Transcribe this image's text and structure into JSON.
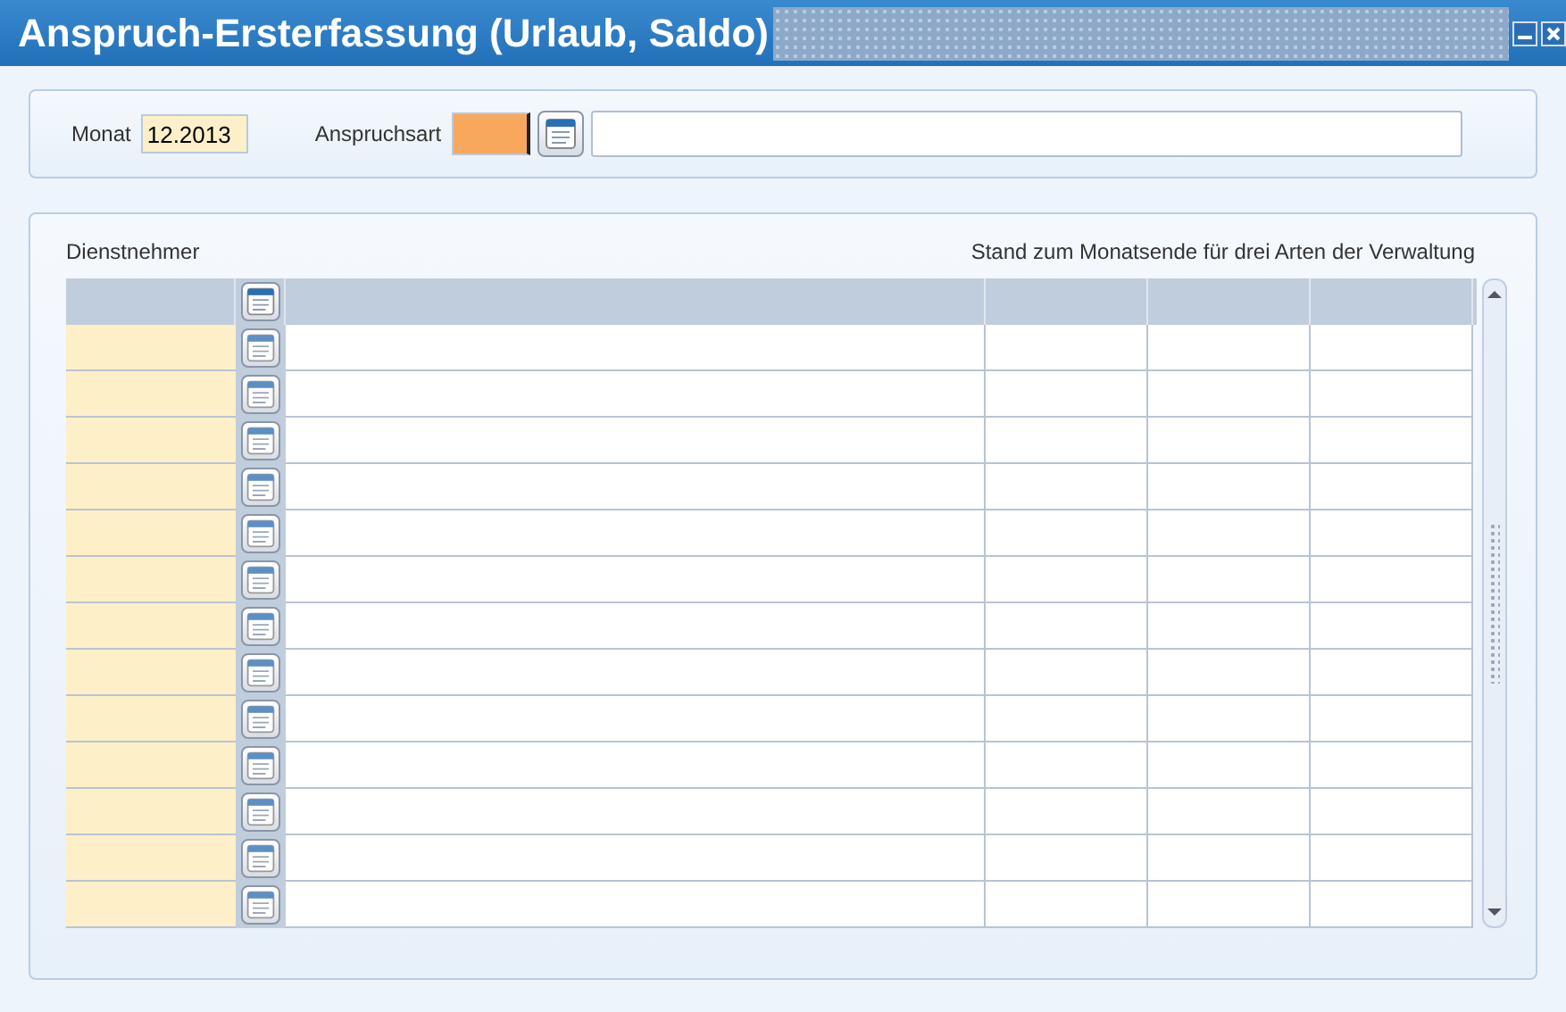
{
  "window": {
    "title": "Anspruch-Ersterfassung (Urlaub, Saldo)"
  },
  "filter": {
    "month_label": "Monat",
    "month_value": "12.2013",
    "type_label": "Anspruchsart",
    "type_focused": true,
    "type_lookup": true
  },
  "table": {
    "left_label": "Dienstnehmer",
    "right_label": "Stand zum Monatsende für drei Arten der Verwaltung",
    "header_lookup": true,
    "rows": [
      {
        "lookup": true
      },
      {
        "lookup": true
      },
      {
        "lookup": true
      },
      {
        "lookup": true
      },
      {
        "lookup": true
      },
      {
        "lookup": true
      },
      {
        "lookup": true
      },
      {
        "lookup": true
      },
      {
        "lookup": true
      },
      {
        "lookup": true
      },
      {
        "lookup": true
      },
      {
        "lookup": true
      },
      {
        "lookup": true
      }
    ]
  }
}
